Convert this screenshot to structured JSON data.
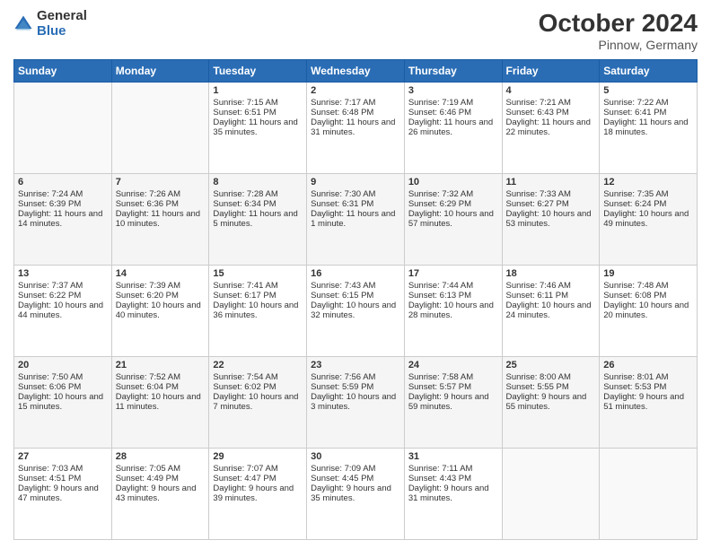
{
  "logo": {
    "general": "General",
    "blue": "Blue"
  },
  "header": {
    "month": "October 2024",
    "location": "Pinnow, Germany"
  },
  "weekdays": [
    "Sunday",
    "Monday",
    "Tuesday",
    "Wednesday",
    "Thursday",
    "Friday",
    "Saturday"
  ],
  "weeks": [
    [
      {
        "day": "",
        "sunrise": "",
        "sunset": "",
        "daylight": ""
      },
      {
        "day": "",
        "sunrise": "",
        "sunset": "",
        "daylight": ""
      },
      {
        "day": "1",
        "sunrise": "Sunrise: 7:15 AM",
        "sunset": "Sunset: 6:51 PM",
        "daylight": "Daylight: 11 hours and 35 minutes."
      },
      {
        "day": "2",
        "sunrise": "Sunrise: 7:17 AM",
        "sunset": "Sunset: 6:48 PM",
        "daylight": "Daylight: 11 hours and 31 minutes."
      },
      {
        "day": "3",
        "sunrise": "Sunrise: 7:19 AM",
        "sunset": "Sunset: 6:46 PM",
        "daylight": "Daylight: 11 hours and 26 minutes."
      },
      {
        "day": "4",
        "sunrise": "Sunrise: 7:21 AM",
        "sunset": "Sunset: 6:43 PM",
        "daylight": "Daylight: 11 hours and 22 minutes."
      },
      {
        "day": "5",
        "sunrise": "Sunrise: 7:22 AM",
        "sunset": "Sunset: 6:41 PM",
        "daylight": "Daylight: 11 hours and 18 minutes."
      }
    ],
    [
      {
        "day": "6",
        "sunrise": "Sunrise: 7:24 AM",
        "sunset": "Sunset: 6:39 PM",
        "daylight": "Daylight: 11 hours and 14 minutes."
      },
      {
        "day": "7",
        "sunrise": "Sunrise: 7:26 AM",
        "sunset": "Sunset: 6:36 PM",
        "daylight": "Daylight: 11 hours and 10 minutes."
      },
      {
        "day": "8",
        "sunrise": "Sunrise: 7:28 AM",
        "sunset": "Sunset: 6:34 PM",
        "daylight": "Daylight: 11 hours and 5 minutes."
      },
      {
        "day": "9",
        "sunrise": "Sunrise: 7:30 AM",
        "sunset": "Sunset: 6:31 PM",
        "daylight": "Daylight: 11 hours and 1 minute."
      },
      {
        "day": "10",
        "sunrise": "Sunrise: 7:32 AM",
        "sunset": "Sunset: 6:29 PM",
        "daylight": "Daylight: 10 hours and 57 minutes."
      },
      {
        "day": "11",
        "sunrise": "Sunrise: 7:33 AM",
        "sunset": "Sunset: 6:27 PM",
        "daylight": "Daylight: 10 hours and 53 minutes."
      },
      {
        "day": "12",
        "sunrise": "Sunrise: 7:35 AM",
        "sunset": "Sunset: 6:24 PM",
        "daylight": "Daylight: 10 hours and 49 minutes."
      }
    ],
    [
      {
        "day": "13",
        "sunrise": "Sunrise: 7:37 AM",
        "sunset": "Sunset: 6:22 PM",
        "daylight": "Daylight: 10 hours and 44 minutes."
      },
      {
        "day": "14",
        "sunrise": "Sunrise: 7:39 AM",
        "sunset": "Sunset: 6:20 PM",
        "daylight": "Daylight: 10 hours and 40 minutes."
      },
      {
        "day": "15",
        "sunrise": "Sunrise: 7:41 AM",
        "sunset": "Sunset: 6:17 PM",
        "daylight": "Daylight: 10 hours and 36 minutes."
      },
      {
        "day": "16",
        "sunrise": "Sunrise: 7:43 AM",
        "sunset": "Sunset: 6:15 PM",
        "daylight": "Daylight: 10 hours and 32 minutes."
      },
      {
        "day": "17",
        "sunrise": "Sunrise: 7:44 AM",
        "sunset": "Sunset: 6:13 PM",
        "daylight": "Daylight: 10 hours and 28 minutes."
      },
      {
        "day": "18",
        "sunrise": "Sunrise: 7:46 AM",
        "sunset": "Sunset: 6:11 PM",
        "daylight": "Daylight: 10 hours and 24 minutes."
      },
      {
        "day": "19",
        "sunrise": "Sunrise: 7:48 AM",
        "sunset": "Sunset: 6:08 PM",
        "daylight": "Daylight: 10 hours and 20 minutes."
      }
    ],
    [
      {
        "day": "20",
        "sunrise": "Sunrise: 7:50 AM",
        "sunset": "Sunset: 6:06 PM",
        "daylight": "Daylight: 10 hours and 15 minutes."
      },
      {
        "day": "21",
        "sunrise": "Sunrise: 7:52 AM",
        "sunset": "Sunset: 6:04 PM",
        "daylight": "Daylight: 10 hours and 11 minutes."
      },
      {
        "day": "22",
        "sunrise": "Sunrise: 7:54 AM",
        "sunset": "Sunset: 6:02 PM",
        "daylight": "Daylight: 10 hours and 7 minutes."
      },
      {
        "day": "23",
        "sunrise": "Sunrise: 7:56 AM",
        "sunset": "Sunset: 5:59 PM",
        "daylight": "Daylight: 10 hours and 3 minutes."
      },
      {
        "day": "24",
        "sunrise": "Sunrise: 7:58 AM",
        "sunset": "Sunset: 5:57 PM",
        "daylight": "Daylight: 9 hours and 59 minutes."
      },
      {
        "day": "25",
        "sunrise": "Sunrise: 8:00 AM",
        "sunset": "Sunset: 5:55 PM",
        "daylight": "Daylight: 9 hours and 55 minutes."
      },
      {
        "day": "26",
        "sunrise": "Sunrise: 8:01 AM",
        "sunset": "Sunset: 5:53 PM",
        "daylight": "Daylight: 9 hours and 51 minutes."
      }
    ],
    [
      {
        "day": "27",
        "sunrise": "Sunrise: 7:03 AM",
        "sunset": "Sunset: 4:51 PM",
        "daylight": "Daylight: 9 hours and 47 minutes."
      },
      {
        "day": "28",
        "sunrise": "Sunrise: 7:05 AM",
        "sunset": "Sunset: 4:49 PM",
        "daylight": "Daylight: 9 hours and 43 minutes."
      },
      {
        "day": "29",
        "sunrise": "Sunrise: 7:07 AM",
        "sunset": "Sunset: 4:47 PM",
        "daylight": "Daylight: 9 hours and 39 minutes."
      },
      {
        "day": "30",
        "sunrise": "Sunrise: 7:09 AM",
        "sunset": "Sunset: 4:45 PM",
        "daylight": "Daylight: 9 hours and 35 minutes."
      },
      {
        "day": "31",
        "sunrise": "Sunrise: 7:11 AM",
        "sunset": "Sunset: 4:43 PM",
        "daylight": "Daylight: 9 hours and 31 minutes."
      },
      {
        "day": "",
        "sunrise": "",
        "sunset": "",
        "daylight": ""
      },
      {
        "day": "",
        "sunrise": "",
        "sunset": "",
        "daylight": ""
      }
    ]
  ]
}
